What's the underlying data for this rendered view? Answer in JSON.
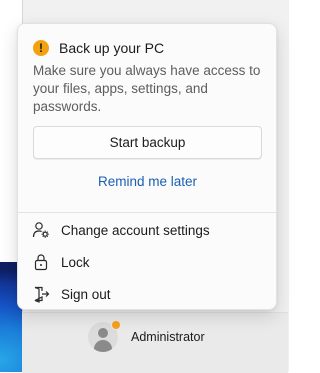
{
  "notice": {
    "title": "Back up your PC",
    "body": "Make sure you always have access to your files, apps, settings, and passwords.",
    "primary_button": "Start backup",
    "secondary_link": "Remind me later",
    "icon": "warning-icon",
    "link_color": "#1a5fb4",
    "warning_color": "#f2a20f"
  },
  "menu": {
    "items": [
      {
        "label": "Change account settings",
        "icon": "account-settings-icon"
      },
      {
        "label": "Lock",
        "icon": "lock-icon"
      },
      {
        "label": "Sign out",
        "icon": "sign-out-icon"
      }
    ]
  },
  "user": {
    "name": "Administrator",
    "badge_color": "#f7a21b"
  }
}
